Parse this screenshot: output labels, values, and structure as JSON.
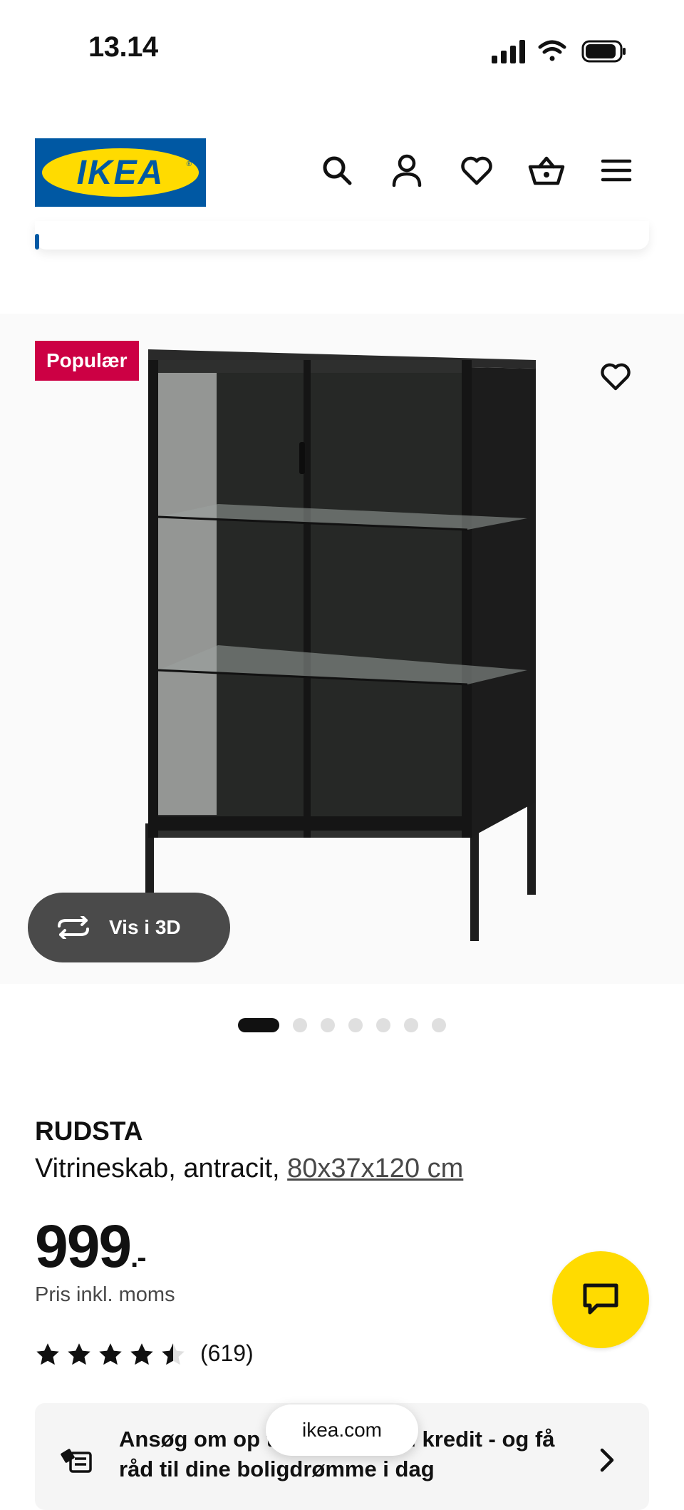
{
  "status_bar": {
    "time": "13.14"
  },
  "header": {
    "logo_text": "IKEA",
    "icons": [
      "search-icon",
      "profile-icon",
      "heart-icon",
      "basket-icon",
      "menu-icon"
    ]
  },
  "product_image": {
    "badge": "Populær",
    "view_3d_label": "Vis i 3D",
    "carousel": {
      "total": 7,
      "active_index": 0
    }
  },
  "product": {
    "name": "RUDSTA",
    "description": "Vitrineskab, antracit,",
    "dimensions": "80x37x120 cm",
    "price_integer": "999",
    "price_decimal": ".-",
    "price_note": "Pris inkl. moms",
    "rating_value": 4.5,
    "rating_max": 5,
    "rating_count": "(619)"
  },
  "promo": {
    "text": "Ansøg om op til 150.000 kr. i kredit - og få råd til dine boligdrømme i dag"
  },
  "browser": {
    "url": "ikea.com"
  },
  "colors": {
    "brand_blue": "#0058a3",
    "brand_yellow": "#ffdb00",
    "badge_red": "#cc0044",
    "button_dark": "#4a4a4a"
  }
}
